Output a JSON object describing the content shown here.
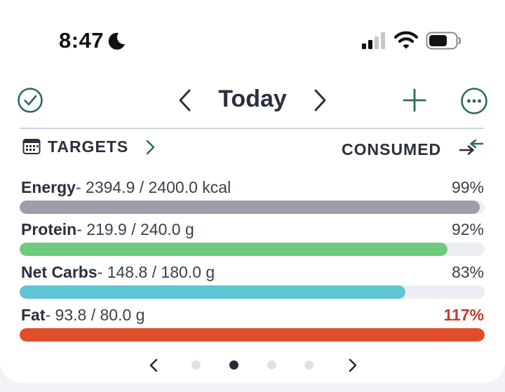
{
  "status_bar": {
    "time": "8:47",
    "icons": [
      "moon-icon",
      "signal-icon",
      "wifi-icon",
      "battery-icon"
    ]
  },
  "header": {
    "title": "Today",
    "icons": [
      "check-circle-icon",
      "chevron-left-icon",
      "chevron-right-icon",
      "plus-icon",
      "more-icon"
    ]
  },
  "summary": {
    "targets_label": "TARGETS",
    "consumed_label": "CONSUMED"
  },
  "nutrients": [
    {
      "name": "Energy",
      "amount": "- 2394.9 / 2400.0 kcal",
      "percent": "99%",
      "fill": 0.99,
      "color": "#9c9eab"
    },
    {
      "name": "Protein",
      "amount": "- 219.9 / 240.0 g",
      "percent": "92%",
      "fill": 0.92,
      "color": "#6ecb7e"
    },
    {
      "name": "Net Carbs",
      "amount": "- 148.8 / 180.0 g",
      "percent": "83%",
      "fill": 0.83,
      "color": "#5ec5d2"
    },
    {
      "name": "Fat",
      "amount": "- 93.8 / 80.0 g",
      "percent": "117%",
      "fill": 1.0,
      "color": "#e14e2c"
    }
  ],
  "pager": {
    "pages": 4,
    "active_index": 1
  },
  "colors": {
    "accent": "#2d6b62",
    "over_target": "#c53a2a"
  }
}
